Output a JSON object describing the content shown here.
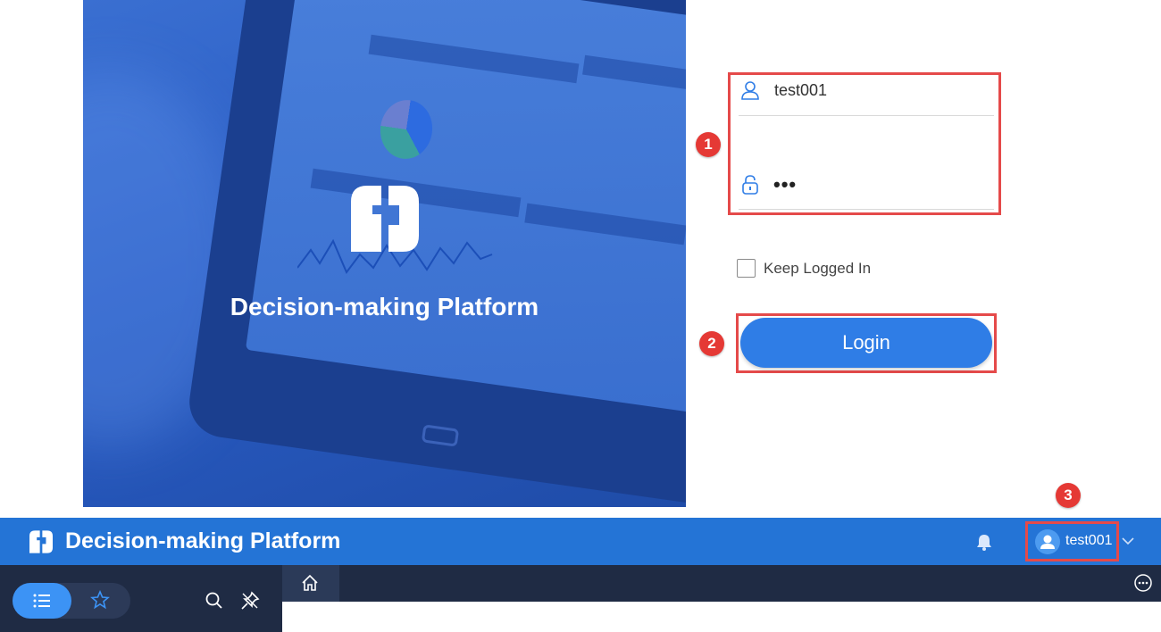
{
  "hero": {
    "title": "Decision-making Platform"
  },
  "login_form": {
    "username_value": "test001",
    "password_value": "•••",
    "keep_logged_in_label": "Keep Logged In",
    "login_button_label": "Login"
  },
  "annotations": {
    "step1": "1",
    "step2": "2",
    "step3": "3",
    "highlight_color": "#e54a4a"
  },
  "topbar": {
    "title": "Decision-making Platform",
    "user_name": "test001",
    "background": "#2474d6"
  },
  "icons": {
    "user": "user-icon",
    "lock": "lock-icon",
    "bell": "bell-icon",
    "avatar": "avatar-icon",
    "chevron": "chevron-down-icon",
    "list": "list-icon",
    "star": "star-icon",
    "search": "search-icon",
    "pin": "unpin-icon",
    "home": "home-icon",
    "more": "more-icon"
  }
}
